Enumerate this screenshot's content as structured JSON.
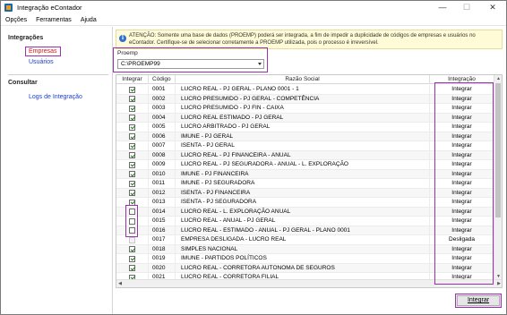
{
  "window": {
    "title": "Integração eContador",
    "minimize": "—",
    "maximize": "☐",
    "close": "✕"
  },
  "menu": [
    {
      "label": "Opções"
    },
    {
      "label": "Ferramentas"
    },
    {
      "label": "Ajuda"
    }
  ],
  "sidebar": {
    "section1": "Integrações",
    "link_empresas": "Empresas",
    "link_usuarios": "Usuários",
    "section2": "Consultar",
    "link_logs": "Logs de Integração"
  },
  "warning": {
    "line1": "ATENÇÃO: Somente uma base de dados (PROEMP) poderá ser integrada, a fim de impedir a duplicidade de códigos de empresas e usuários no",
    "line2": "eContador. Certifique-se de selecionar corretamente a PROEMP utilizada, pois o processo é irreversível."
  },
  "proemp": {
    "label": "Proemp",
    "value": "C:\\PROEMP99"
  },
  "table": {
    "headers": {
      "integrar": "Integrar",
      "codigo": "Código",
      "razao": "Razão Social",
      "integracao": "Integração"
    },
    "rows": [
      {
        "checked": true,
        "disabled": false,
        "codigo": "0001",
        "razao": "LUCRO REAL - PJ GERAL - PLANO 0001 - 1",
        "status": "Integrar"
      },
      {
        "checked": true,
        "disabled": false,
        "codigo": "0002",
        "razao": "LUCRO PRESUMIDO - PJ GERAL - COMPETÊNCIA",
        "status": "Integrar"
      },
      {
        "checked": true,
        "disabled": false,
        "codigo": "0003",
        "razao": "LUCRO PRESUMIDO - PJ FIN - CAIXA",
        "status": "Integrar"
      },
      {
        "checked": true,
        "disabled": false,
        "codigo": "0004",
        "razao": "LUCRO REAL ESTIMADO - PJ GERAL",
        "status": "Integrar"
      },
      {
        "checked": true,
        "disabled": false,
        "codigo": "0005",
        "razao": "LUCRO ARBITRADO - PJ GERAL",
        "status": "Integrar"
      },
      {
        "checked": true,
        "disabled": false,
        "codigo": "0006",
        "razao": "IMUNE - PJ GERAL",
        "status": "Integrar"
      },
      {
        "checked": true,
        "disabled": false,
        "codigo": "0007",
        "razao": "ISENTA - PJ GERAL",
        "status": "Integrar"
      },
      {
        "checked": true,
        "disabled": false,
        "codigo": "0008",
        "razao": "LUCRO REAL - PJ FINANCEIRA - ANUAL",
        "status": "Integrar"
      },
      {
        "checked": true,
        "disabled": false,
        "codigo": "0009",
        "razao": "LUCRO REAL - PJ SEGURADORA - ANUAL - L. EXPLORAÇÃO",
        "status": "Integrar"
      },
      {
        "checked": true,
        "disabled": false,
        "codigo": "0010",
        "razao": "IMUNE - PJ FINANCEIRA",
        "status": "Integrar"
      },
      {
        "checked": true,
        "disabled": false,
        "codigo": "0011",
        "razao": "IMUNE - PJ SEGURADORA",
        "status": "Integrar"
      },
      {
        "checked": true,
        "disabled": false,
        "codigo": "0012",
        "razao": "ISENTA - PJ FINANCEIRA",
        "status": "Integrar"
      },
      {
        "checked": true,
        "disabled": false,
        "codigo": "0013",
        "razao": "ISENTA - PJ SEGURADORA",
        "status": "Integrar"
      },
      {
        "checked": false,
        "disabled": false,
        "codigo": "0014",
        "razao": "LUCRO REAL - L. EXPLORAÇÃO ANUAL",
        "status": "Integrar"
      },
      {
        "checked": false,
        "disabled": false,
        "codigo": "0015",
        "razao": "LUCRO REAL - ANUAL - PJ GERAL",
        "status": "Integrar"
      },
      {
        "checked": false,
        "disabled": false,
        "codigo": "0016",
        "razao": "LUCRO REAL - ESTIMADO - ANUAL - PJ GERAL - PLANO 0001",
        "status": "Integrar"
      },
      {
        "checked": false,
        "disabled": true,
        "codigo": "0017",
        "razao": "EMPRESA DESLIGADA - LUCRO REAL",
        "status": "Desligada"
      },
      {
        "checked": true,
        "disabled": false,
        "codigo": "0018",
        "razao": "SIMPLES NACIONAL",
        "status": "Integrar"
      },
      {
        "checked": true,
        "disabled": false,
        "codigo": "0019",
        "razao": "IMUNE - PARTIDOS POLÍTICOS",
        "status": "Integrar"
      },
      {
        "checked": true,
        "disabled": false,
        "codigo": "0020",
        "razao": "LUCRO REAL - CORRETORA AUTONOMA DE SEGUROS",
        "status": "Integrar"
      },
      {
        "checked": true,
        "disabled": false,
        "codigo": "0021",
        "razao": "LUCRO REAL - CORRETORA FILIAL",
        "status": "Integrar"
      }
    ]
  },
  "button": {
    "integrar": "Integrar"
  },
  "colors": {
    "highlight": "#9b2fae",
    "link": "#1a3ed0",
    "active_link": "#dd1111",
    "warning_bg": "#fffbd6"
  }
}
